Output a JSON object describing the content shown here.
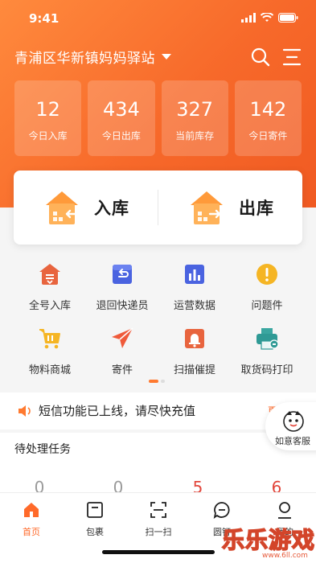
{
  "status_bar": {
    "time": "9:41"
  },
  "header": {
    "station_name": "青浦区华新镇妈妈驿站"
  },
  "stats": [
    {
      "value": "12",
      "label": "今日入库"
    },
    {
      "value": "434",
      "label": "今日出库"
    },
    {
      "value": "327",
      "label": "当前库存"
    },
    {
      "value": "142",
      "label": "今日寄件"
    }
  ],
  "io": {
    "inbound_label": "入库",
    "outbound_label": "出库"
  },
  "grid": [
    {
      "label": "全号入库",
      "icon": "inbox-stack-icon"
    },
    {
      "label": "退回快递员",
      "icon": "return-box-icon"
    },
    {
      "label": "运营数据",
      "icon": "bar-chart-icon"
    },
    {
      "label": "问题件",
      "icon": "exclamation-icon"
    },
    {
      "label": "物料商城",
      "icon": "shopping-cart-icon"
    },
    {
      "label": "寄件",
      "icon": "paper-plane-icon"
    },
    {
      "label": "扫描催提",
      "icon": "bell-box-icon"
    },
    {
      "label": "取货码打印",
      "icon": "printer-icon"
    }
  ],
  "notice": {
    "text": "短信功能已上线，请尽快充值",
    "more": "更多"
  },
  "float_service": {
    "label": "如意客服"
  },
  "tasks": {
    "title": "待处理任务",
    "values": [
      "0",
      "0",
      "5",
      "6"
    ]
  },
  "tabs": [
    {
      "label": "首页",
      "icon": "home-icon",
      "active": true
    },
    {
      "label": "包裹",
      "icon": "package-icon"
    },
    {
      "label": "扫一扫",
      "icon": "scan-icon"
    },
    {
      "label": "圆钉",
      "icon": "chat-icon"
    },
    {
      "label": "我的",
      "icon": "user-icon"
    }
  ],
  "watermark": {
    "text": "乐乐游戏",
    "url": "www.6ll.com"
  },
  "colors": {
    "accent": "#ff6a2a",
    "gradient_start": "#ff8a3d",
    "gradient_end": "#f05a22",
    "task_alert": "#e2453a"
  }
}
